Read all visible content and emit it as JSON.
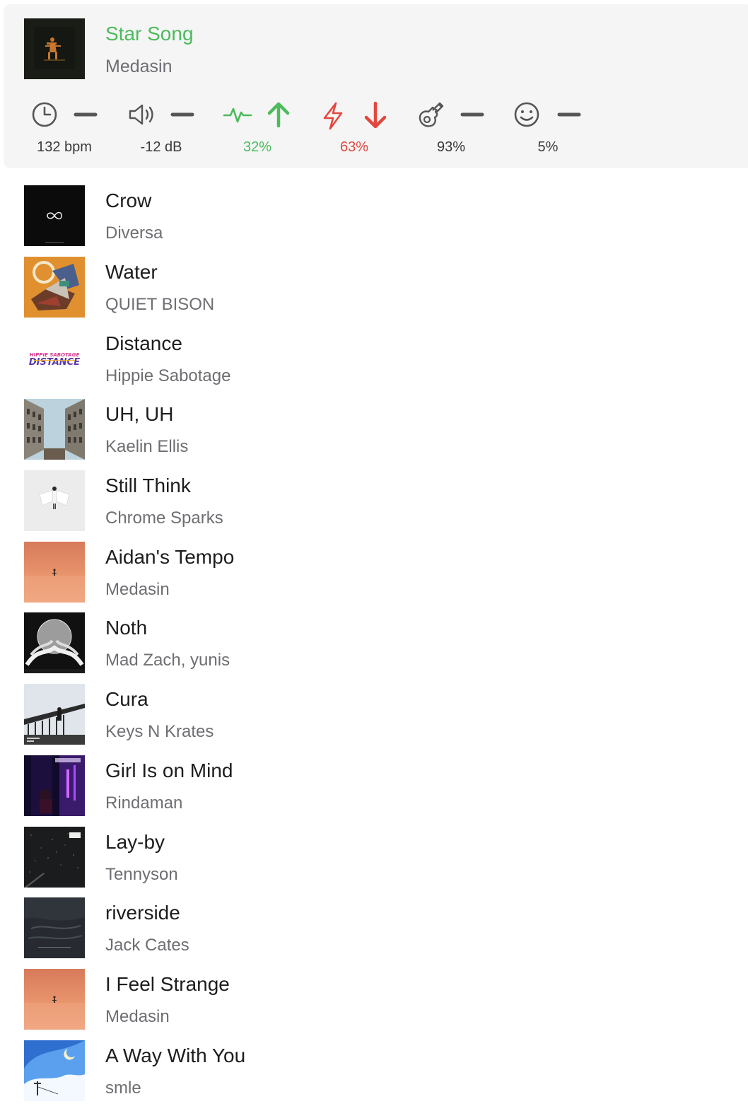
{
  "colors": {
    "accent_green": "#4cbb5c",
    "accent_red": "#e2473f",
    "neutral_icon": "#555555",
    "secondary_text": "#6e6e73",
    "header_bg": "#f5f5f5"
  },
  "now_playing": {
    "title": "Star Song",
    "artist": "Medasin",
    "cover": "dark-cover-with-orange-figure",
    "metrics": [
      {
        "icon": "clock-icon",
        "indicator": "dash-icon",
        "value": "132 bpm",
        "color": "#3a3a3c"
      },
      {
        "icon": "speaker-icon",
        "indicator": "dash-icon",
        "value": "-12 dB",
        "color": "#3a3a3c"
      },
      {
        "icon": "pulse-icon",
        "indicator": "arrow-up-icon",
        "value": "32%",
        "color": "#4cbb5c"
      },
      {
        "icon": "lightning-icon",
        "indicator": "arrow-down-icon",
        "value": "63%",
        "color": "#e2473f"
      },
      {
        "icon": "guitar-icon",
        "indicator": "dash-icon",
        "value": "93%",
        "color": "#3a3a3c"
      },
      {
        "icon": "smiley-icon",
        "indicator": "dash-icon",
        "value": "5%",
        "color": "#3a3a3c"
      }
    ]
  },
  "tracks": [
    {
      "title": "Crow",
      "artist": "Diversa",
      "cover": "black-with-infinity-symbol"
    },
    {
      "title": "Water",
      "artist": "QUIET BISON",
      "cover": "orange-abstract"
    },
    {
      "title": "Distance",
      "artist": "Hippie Sabotage",
      "cover": "white-with-distance-lettering",
      "cover_text": "HIPPIE SABOTAGE DISTANCE"
    },
    {
      "title": "UH, UH",
      "artist": "Kaelin Ellis",
      "cover": "buildings-looking-up"
    },
    {
      "title": "Still Think",
      "artist": "Chrome Sparks",
      "cover": "white-figure-light"
    },
    {
      "title": "Aidan's Tempo",
      "artist": "Medasin",
      "cover": "peach-gradient-figure"
    },
    {
      "title": "Noth",
      "artist": "Mad Zach, yunis",
      "cover": "black-white-illustration"
    },
    {
      "title": "Cura",
      "artist": "Keys N Krates",
      "cover": "railing-sky"
    },
    {
      "title": "Girl Is on Mind",
      "artist": "Rindaman",
      "cover": "purple-neon-night"
    },
    {
      "title": "Lay-by",
      "artist": "Tennyson",
      "cover": "dark-starry-road"
    },
    {
      "title": "riverside",
      "artist": "Jack Cates",
      "cover": "dark-water-texture"
    },
    {
      "title": "I Feel Strange",
      "artist": "Medasin",
      "cover": "peach-gradient-figure"
    },
    {
      "title": "A Way With You",
      "artist": "smle",
      "cover": "blue-sky-cartoon"
    }
  ]
}
